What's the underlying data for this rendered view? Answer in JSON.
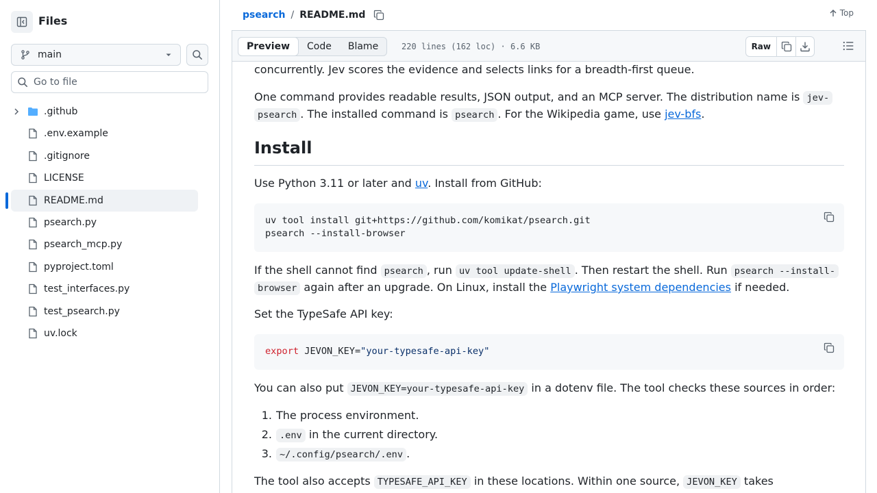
{
  "sidebar": {
    "title": "Files",
    "branch": "main",
    "goto_placeholder": "Go to file",
    "items": [
      {
        "name": ".github",
        "type": "folder"
      },
      {
        "name": ".env.example",
        "type": "file"
      },
      {
        "name": ".gitignore",
        "type": "file"
      },
      {
        "name": "LICENSE",
        "type": "file"
      },
      {
        "name": "README.md",
        "type": "file",
        "selected": true
      },
      {
        "name": "psearch.py",
        "type": "file"
      },
      {
        "name": "psearch_mcp.py",
        "type": "file"
      },
      {
        "name": "pyproject.toml",
        "type": "file"
      },
      {
        "name": "test_interfaces.py",
        "type": "file"
      },
      {
        "name": "test_psearch.py",
        "type": "file"
      },
      {
        "name": "uv.lock",
        "type": "file"
      }
    ]
  },
  "header": {
    "repo": "psearch",
    "separator": "/",
    "file": "README.md",
    "top_label": "Top"
  },
  "toolbar": {
    "tabs": [
      "Preview",
      "Code",
      "Blame"
    ],
    "active_tab": "Preview",
    "stats": "220 lines (162 loc) · 6.6 KB",
    "raw_label": "Raw"
  },
  "readme": {
    "p0": "concurrently. Jev scores the evidence and selects links for a breadth-first queue.",
    "p1": {
      "a": "One command provides readable results, JSON output, and an MCP server. The distribution name is ",
      "code1": "jev-",
      "code1b": "psearch",
      "b": ". The installed command is ",
      "code2": "psearch",
      "c": ". For the Wikipedia game, use ",
      "link": "jev-bfs",
      "d": "."
    },
    "install_heading": "Install",
    "p2": {
      "a": "Use Python 3.11 or later and ",
      "link": "uv",
      "b": ". Install from GitHub:"
    },
    "code_block1": [
      "uv tool install git+https://github.com/komikat/psearch.git",
      "psearch --install-browser"
    ],
    "p3": {
      "a": "If the shell cannot find ",
      "code1": "psearch",
      "b": ", run ",
      "code2": "uv tool update-shell",
      "c": ". Then restart the shell. Run ",
      "code3": "psearch --install-",
      "code3b": "browser",
      "d": " again after an upgrade. On Linux, install the ",
      "link": "Playwright system dependencies",
      "e": " if needed."
    },
    "p4": "Set the TypeSafe API key:",
    "code_block2": {
      "keyword": "export",
      "var": " JEVON_KEY=",
      "value": "\"your-typesafe-api-key\""
    },
    "p5": {
      "a": "You can also put ",
      "code": "JEVON_KEY=your-typesafe-api-key",
      "b": " in a dotenv file. The tool checks these sources in order:"
    },
    "list": [
      {
        "num": "1.",
        "text": "The process environment."
      },
      {
        "num": "2.",
        "code": ".env",
        "text": " in the current directory."
      },
      {
        "num": "3.",
        "code": "~/.config/psearch/.env",
        "text": "."
      }
    ],
    "p6": {
      "a": "The tool also accepts ",
      "code1": "TYPESAFE_API_KEY",
      "b": " in these locations. Within one source, ",
      "code2": "JEVON_KEY",
      "c": " takes"
    }
  },
  "colors": {
    "accent": "#0969da",
    "folder": "#54aeff",
    "keyword": "#cf222e",
    "string": "#0a3069"
  }
}
